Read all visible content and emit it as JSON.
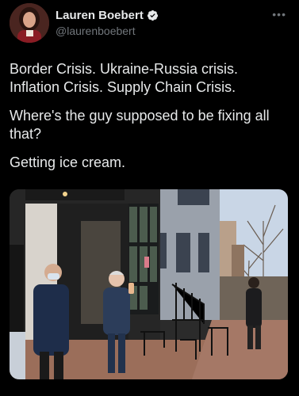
{
  "author": {
    "name": "Lauren Boebert",
    "handle": "@laurenboebert",
    "verified": true
  },
  "menu_icon": "more-horizontal-icon",
  "tweet": {
    "paragraphs": [
      "Border Crisis. Ukraine-Russia crisis. Inflation Crisis. Supply Chain Crisis.",
      "Where's the guy supposed to be fixing all that?",
      "Getting ice cream."
    ]
  },
  "colors": {
    "background": "#000000",
    "text": "#e7e9ea",
    "secondary": "#71767b",
    "verified_badge": "#1d9bf0"
  }
}
